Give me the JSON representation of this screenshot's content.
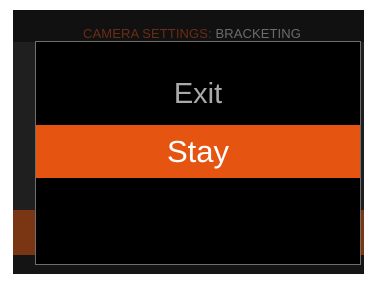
{
  "header": {
    "category": "CAMERA SETTINGS:",
    "page": "BRACKETING"
  },
  "dialog": {
    "options": [
      {
        "label": "Exit",
        "selected": false
      },
      {
        "label": "Stay",
        "selected": true
      }
    ]
  },
  "colors": {
    "selection": "#e65412",
    "dialog_background": "#000000",
    "dialog_border": "#6e6e6e",
    "unselected_text": "#a9a9a9",
    "selected_text": "#ffffff",
    "category_text": "#6a2d14"
  }
}
